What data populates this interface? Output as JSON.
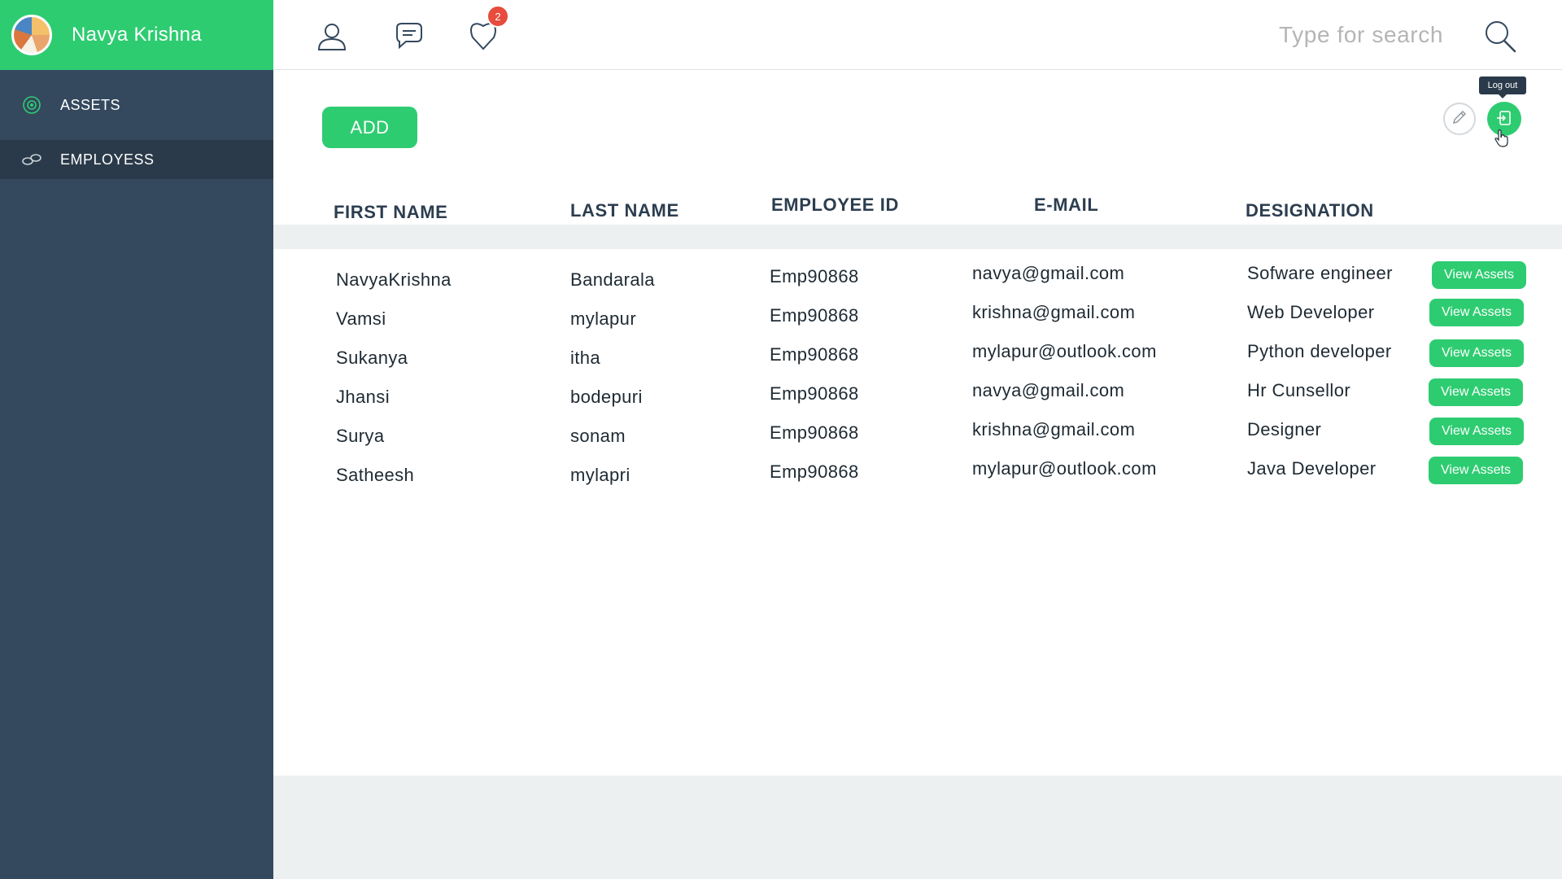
{
  "profile": {
    "name": "Navya Krishna"
  },
  "sidebar": {
    "items": [
      {
        "label": "ASSETS",
        "icon": "target-icon",
        "active": false
      },
      {
        "label": "EMPLOYESS",
        "icon": "link-icon",
        "active": true
      }
    ]
  },
  "topbar": {
    "icons": [
      "user-icon",
      "chat-icon",
      "notification-icon"
    ],
    "notification_count": "2",
    "search": {
      "placeholder": "Type for search",
      "value": ""
    }
  },
  "toolbar": {
    "add_label": "ADD",
    "logout_tooltip": "Log out"
  },
  "table": {
    "columns": [
      "FIRST NAME",
      "LAST NAME",
      "EMPLOYEE ID",
      "E-MAIL",
      "DESIGNATION"
    ],
    "action_label": "View Assets",
    "rows": [
      {
        "first": "NavyaKrishna",
        "last": "Bandarala",
        "id": "Emp90868",
        "email": "navya@gmail.com",
        "designation": "Sofware engineer"
      },
      {
        "first": "Vamsi",
        "last": "mylapur",
        "id": "Emp90868",
        "email": "krishna@gmail.com",
        "designation": "Web Developer"
      },
      {
        "first": "Sukanya",
        "last": "itha",
        "id": "Emp90868",
        "email": "mylapur@outlook.com",
        "designation": "Python developer"
      },
      {
        "first": "Jhansi",
        "last": "bodepuri",
        "id": "Emp90868",
        "email": "navya@gmail.com",
        "designation": "Hr Cunsellor"
      },
      {
        "first": "Surya",
        "last": "sonam",
        "id": "Emp90868",
        "email": "krishna@gmail.com",
        "designation": "Designer"
      },
      {
        "first": "Satheesh",
        "last": "mylapri",
        "id": "Emp90868",
        "email": "mylapur@outlook.com",
        "designation": "Java Developer"
      }
    ]
  },
  "colors": {
    "accent": "#2ecc71",
    "sidebar": "#34495e",
    "sidebar_active": "#2b3a4a",
    "badge": "#e74c3c"
  }
}
